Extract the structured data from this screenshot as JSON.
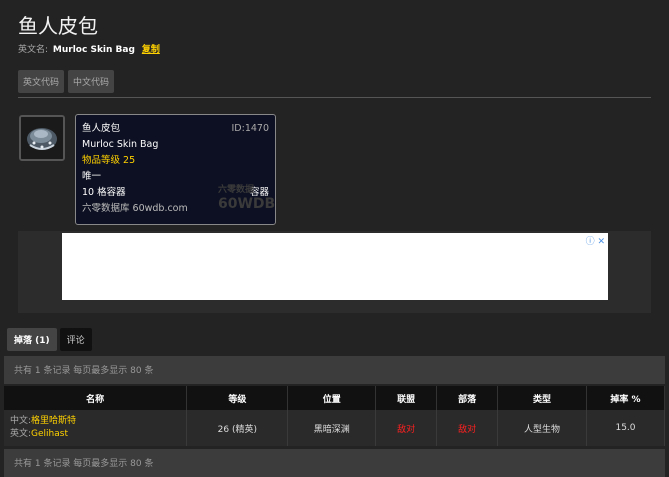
{
  "item": {
    "title": "鱼人皮包",
    "en_label": "英文名:",
    "en_name": "Murloc Skin Bag",
    "copy_label": "复制"
  },
  "code_buttons": [
    "英文代码",
    "中文代码"
  ],
  "tooltip": {
    "name_cn": "鱼人皮包",
    "id": "ID:1470",
    "name_en": "Murloc Skin Bag",
    "item_level": "物品等级 25",
    "unique": "唯一",
    "slots": "10 格容器",
    "container": "容器",
    "source": "六零数据库 60wdb.com",
    "watermark_top": "六零数据",
    "watermark_bottom": "60WDB"
  },
  "ad": {
    "icon": "ⓘ ✕"
  },
  "tabs": [
    {
      "label": "掉落 (1)",
      "active": true
    },
    {
      "label": "评论",
      "active": false
    }
  ],
  "summary": "共有 1 条记录 每页最多显示 80 条",
  "table": {
    "headers": [
      "名称",
      "等级",
      "位置",
      "联盟",
      "部落",
      "类型",
      "掉率 %"
    ],
    "rows": [
      {
        "cn_label": "中文:",
        "cn_name": "格里哈斯特",
        "en_label": "英文:",
        "en_name": "Gelihast",
        "level": "26 (精英)",
        "location": "黑暗深渊",
        "alliance": "敌对",
        "horde": "敌对",
        "type": "人型生物",
        "rate": "15.0"
      }
    ]
  },
  "colors": {
    "accent": "#ffd100",
    "hostile": "#ff2020"
  }
}
